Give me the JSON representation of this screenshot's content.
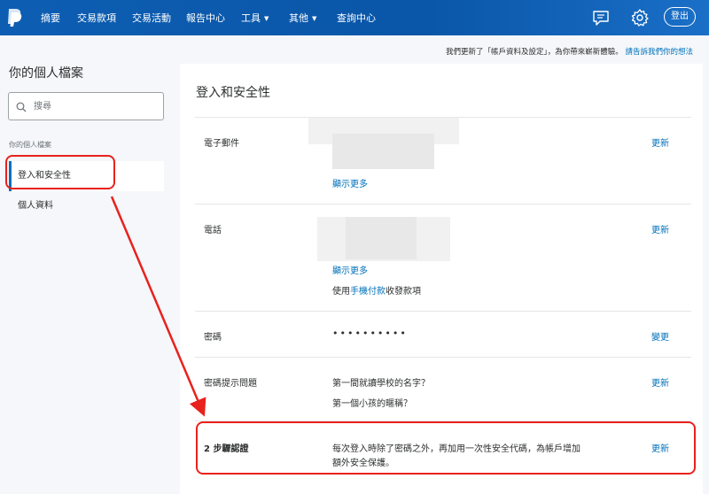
{
  "nav": {
    "items": [
      "摘要",
      "交易款項",
      "交易活動",
      "報告中心",
      "工具",
      "其他",
      "查詢中心"
    ],
    "logout": "登出",
    "icons": [
      "paypal-logo",
      "message-center-icon",
      "gear-icon"
    ]
  },
  "notice": {
    "text": "我們更新了「帳戶資料及設定」，為你帶來嶄新體驗。",
    "link": "請告訴我們你的想法"
  },
  "sidebar": {
    "title": "你的個人檔案",
    "search_placeholder": "搜尋",
    "section_label": "你的個人檔案",
    "items": [
      {
        "label": "登入和安全性",
        "active": true
      },
      {
        "label": "個人資料",
        "active": false
      }
    ]
  },
  "main": {
    "title": "登入和安全性",
    "rows": {
      "email": {
        "label": "電子郵件",
        "show_more": "顯示更多",
        "action": "更新"
      },
      "phone": {
        "label": "電話",
        "show_more": "顯示更多",
        "extra": "使用手機付款收發款項",
        "action": "更新"
      },
      "password": {
        "label": "密碼",
        "value": "••••••••••",
        "action": "變更"
      },
      "security_questions": {
        "label": "密碼提示問題",
        "q1": "第一間就讀學校的名字？",
        "q2": "第一個小孩的暱稱？",
        "action": "更新"
      },
      "two_step": {
        "label": "2 步驟認證",
        "desc_line1": "每次登入時除了密碼之外，再加用一次性安全代碼，為帳戶增加",
        "desc_line2": "額外安全保護。",
        "action": "更新"
      }
    }
  },
  "colors": {
    "brand": "#0d5eb3",
    "link": "#0070ba",
    "annotation": "#e8221c"
  }
}
